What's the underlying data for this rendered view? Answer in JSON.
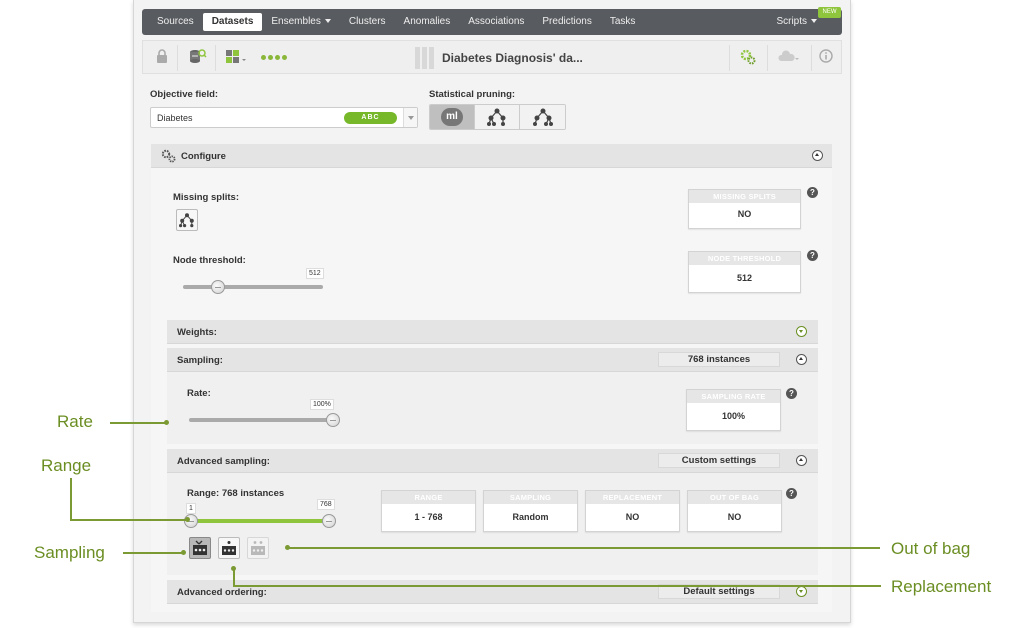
{
  "nav": {
    "items": [
      {
        "label": "Sources",
        "active": false,
        "caret": false
      },
      {
        "label": "Datasets",
        "active": true,
        "caret": false
      },
      {
        "label": "Ensembles",
        "active": false,
        "caret": true
      },
      {
        "label": "Clusters",
        "active": false,
        "caret": false
      },
      {
        "label": "Anomalies",
        "active": false,
        "caret": false
      },
      {
        "label": "Associations",
        "active": false,
        "caret": false
      },
      {
        "label": "Predictions",
        "active": false,
        "caret": false
      },
      {
        "label": "Tasks",
        "active": false,
        "caret": false
      }
    ],
    "scripts_label": "Scripts",
    "new_badge": "NEW"
  },
  "toolbar": {
    "dataset_title": "Diabetes Diagnosis' da..."
  },
  "objective": {
    "label": "Objective field:",
    "value": "Diabetes",
    "type_badge": "ABC"
  },
  "pruning": {
    "label": "Statistical pruning:",
    "ml_badge": "ml"
  },
  "configure": {
    "title": "Configure",
    "missing_splits": {
      "label": "Missing splits:",
      "stat_header": "MISSING SPLITS",
      "stat_value": "NO"
    },
    "node_threshold": {
      "label": "Node threshold:",
      "bubble": "512",
      "value_fraction": 0.25,
      "stat_header": "NODE THRESHOLD",
      "stat_value": "512"
    }
  },
  "weights": {
    "title": "Weights:"
  },
  "sampling": {
    "title": "Sampling:",
    "summary": "768 instances",
    "rate_label": "Rate:",
    "rate_bubble": "100%",
    "rate_fraction": 1.0,
    "stat_header": "SAMPLING RATE",
    "stat_value": "100%"
  },
  "advanced_sampling": {
    "title": "Advanced sampling:",
    "summary": "Custom settings",
    "range_label": "Range: 768 instances",
    "range_min_bubble": "1",
    "range_max_bubble": "768",
    "stats": [
      {
        "header": "RANGE",
        "value": "1 - 768"
      },
      {
        "header": "SAMPLING",
        "value": "Random"
      },
      {
        "header": "REPLACEMENT",
        "value": "NO"
      },
      {
        "header": "OUT OF BAG",
        "value": "NO"
      }
    ]
  },
  "advanced_ordering": {
    "title": "Advanced ordering:",
    "summary": "Default settings"
  },
  "help_glyph": "?",
  "callouts": {
    "rate": "Rate",
    "range": "Range",
    "sampling": "Sampling",
    "out_of_bag": "Out of bag",
    "replacement": "Replacement"
  },
  "colors": {
    "accent_green": "#8fc53c",
    "callout_green": "#6b8e23",
    "nav_bg": "#585b5f"
  }
}
